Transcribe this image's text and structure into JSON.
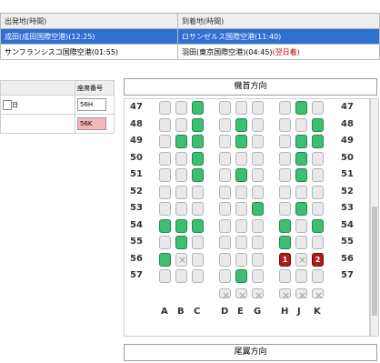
{
  "flights": {
    "header": {
      "dep": "出発地(時間)",
      "arr": "到着地(時間)"
    },
    "rows": [
      {
        "dep": "成田(成田国際空港)(12:25)",
        "arr": "ロサンゼルス国際空港(11:40)",
        "selected": true,
        "next_day": ""
      },
      {
        "dep": "サンフランシスコ国際空港(01:55)",
        "arr": "羽田(東京国際空港)(04:45)",
        "selected": false,
        "next_day": "(翌日着)"
      }
    ]
  },
  "passengers": {
    "seat_header": "座席番号",
    "rows": [
      {
        "day_label": "日",
        "seat": "56H",
        "highlight": false
      },
      {
        "day_label": "",
        "seat": "56K",
        "highlight": true
      }
    ]
  },
  "seatmap": {
    "front_label": "機首方向",
    "rear_label": "尾翼方向",
    "rows": [
      "47",
      "48",
      "49",
      "50",
      "51",
      "52",
      "53",
      "54",
      "55",
      "56",
      "57"
    ],
    "columns": [
      "A",
      "B",
      "C",
      "D",
      "E",
      "G",
      "H",
      "J",
      "K"
    ],
    "seats": [
      "ooa ooo oao",
      "ooa oao ooa",
      "oaa oao oaa",
      "ooa ooo oao",
      "ooa oao oao",
      "ooo ooo ooo",
      "ooo ooa oao",
      "aaa ooo aoa",
      "oao ooo aoo",
      "axo ooo 1x2",
      "ooo oao ooo"
    ],
    "selected_seats": [
      "1",
      "2"
    ],
    "colors": {
      "available": "#3dbe73",
      "occupied": "#e9e9e9",
      "selected": "#b11a1a"
    }
  }
}
